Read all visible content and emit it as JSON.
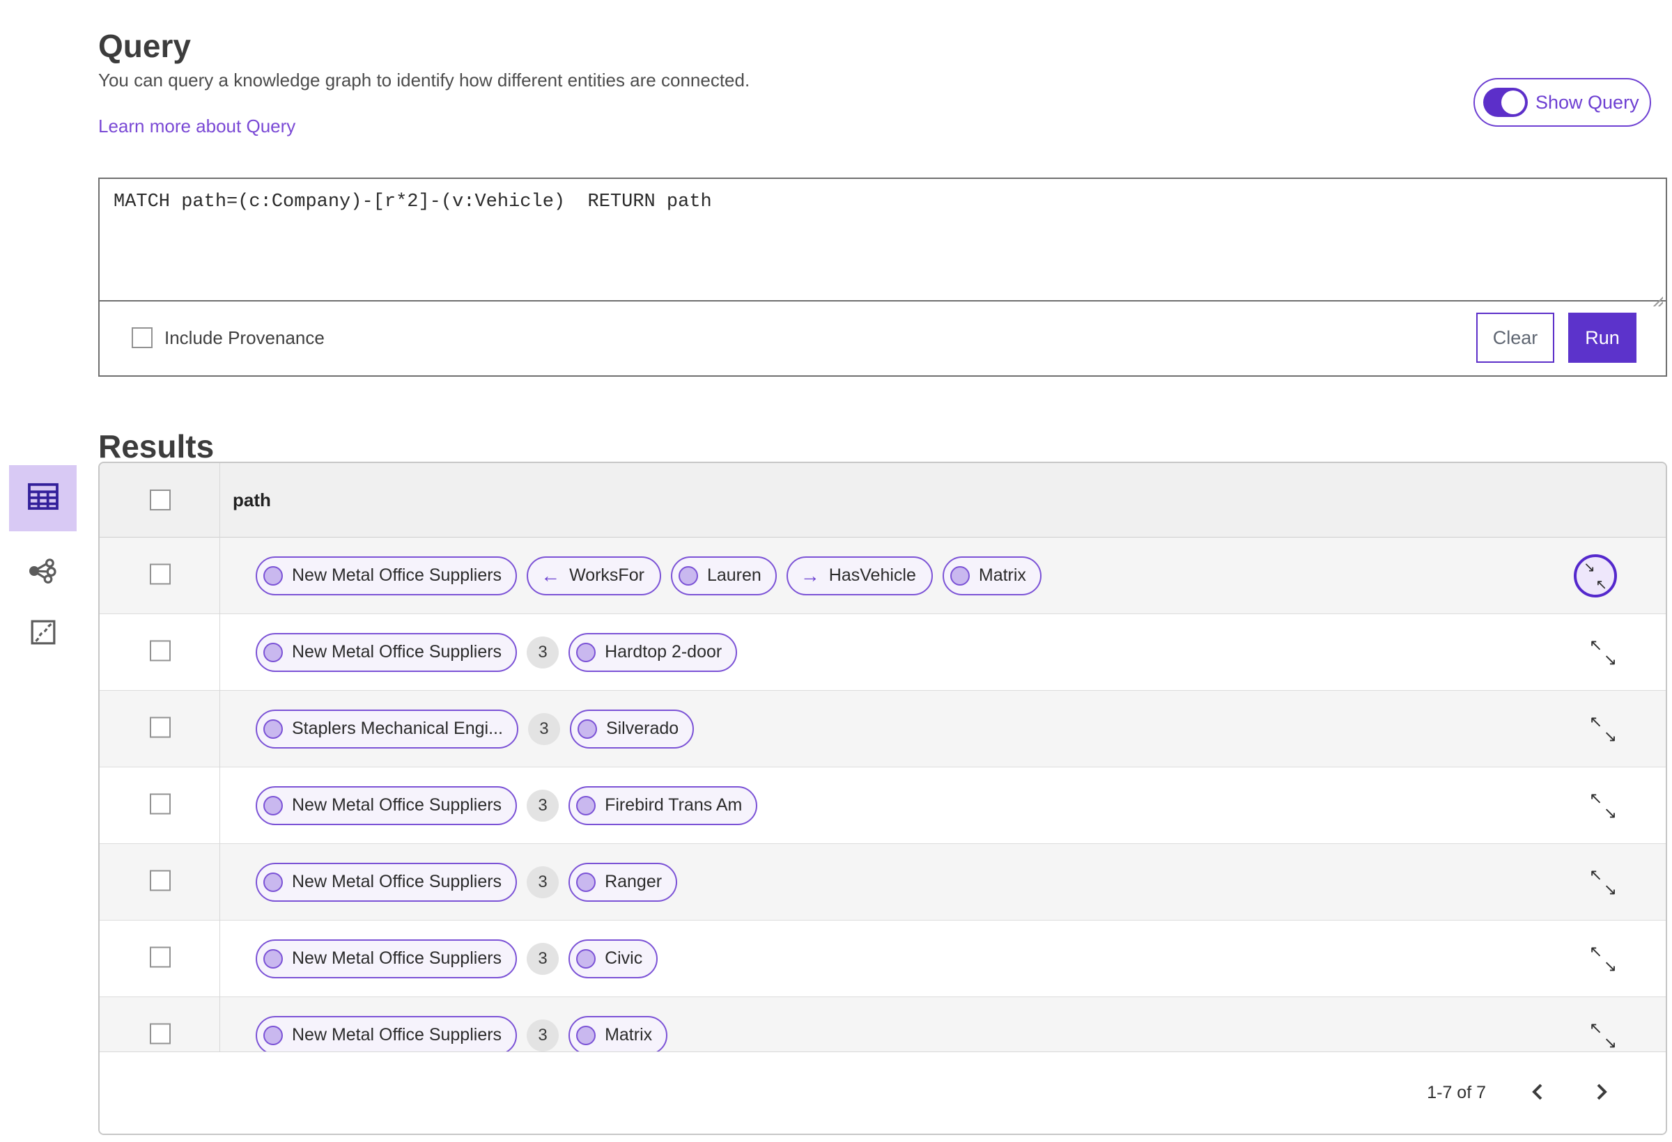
{
  "colors": {
    "accent_purple": "#5c33cb",
    "chip_border_purple": "#7b52d6",
    "chip_fill": "#f6f3fc",
    "selected_view_bg": "#d8c9f4",
    "link_purple": "#7a49d5"
  },
  "query": {
    "title": "Query",
    "description": "You can query a knowledge graph to identify how different entities are connected.",
    "learn_more_label": "Learn more about Query",
    "show_query_label": "Show Query",
    "show_query_on": true,
    "text": "MATCH path=(c:Company)-[r*2]-(v:Vehicle)  RETURN path",
    "include_provenance_label": "Include Provenance",
    "include_provenance_checked": false,
    "clear_label": "Clear",
    "run_label": "Run"
  },
  "results": {
    "title": "Results",
    "column_header": "path",
    "view_switcher": [
      "table-view",
      "graph-view",
      "map-view"
    ],
    "selected_view": "table-view",
    "rows": [
      {
        "expand_icon": "collapse-circled",
        "items": [
          {
            "type": "entity",
            "label": "New Metal Office Suppliers"
          },
          {
            "type": "relation",
            "direction": "left",
            "label": "WorksFor"
          },
          {
            "type": "entity",
            "label": "Lauren"
          },
          {
            "type": "relation",
            "direction": "right",
            "label": "HasVehicle"
          },
          {
            "type": "entity",
            "label": "Matrix"
          }
        ]
      },
      {
        "expand_icon": "expand-diagonal",
        "items": [
          {
            "type": "entity",
            "label": "New Metal Office Suppliers"
          },
          {
            "type": "count",
            "label": "3"
          },
          {
            "type": "entity",
            "label": "Hardtop 2-door"
          }
        ]
      },
      {
        "expand_icon": "expand-diagonal",
        "items": [
          {
            "type": "entity",
            "label": "Staplers Mechanical Engi..."
          },
          {
            "type": "count",
            "label": "3"
          },
          {
            "type": "entity",
            "label": "Silverado"
          }
        ]
      },
      {
        "expand_icon": "expand-diagonal",
        "items": [
          {
            "type": "entity",
            "label": "New Metal Office Suppliers"
          },
          {
            "type": "count",
            "label": "3"
          },
          {
            "type": "entity",
            "label": "Firebird Trans Am"
          }
        ]
      },
      {
        "expand_icon": "expand-diagonal",
        "items": [
          {
            "type": "entity",
            "label": "New Metal Office Suppliers"
          },
          {
            "type": "count",
            "label": "3"
          },
          {
            "type": "entity",
            "label": "Ranger"
          }
        ]
      },
      {
        "expand_icon": "expand-diagonal",
        "items": [
          {
            "type": "entity",
            "label": "New Metal Office Suppliers"
          },
          {
            "type": "count",
            "label": "3"
          },
          {
            "type": "entity",
            "label": "Civic"
          }
        ]
      },
      {
        "expand_icon": "expand-diagonal",
        "items": [
          {
            "type": "entity",
            "label": "New Metal Office Suppliers"
          },
          {
            "type": "count",
            "label": "3"
          },
          {
            "type": "entity",
            "label": "Matrix"
          }
        ]
      }
    ],
    "pagination": {
      "range_label": "1-7 of 7",
      "prev_icon": "chevron-left",
      "next_icon": "chevron-right"
    }
  }
}
